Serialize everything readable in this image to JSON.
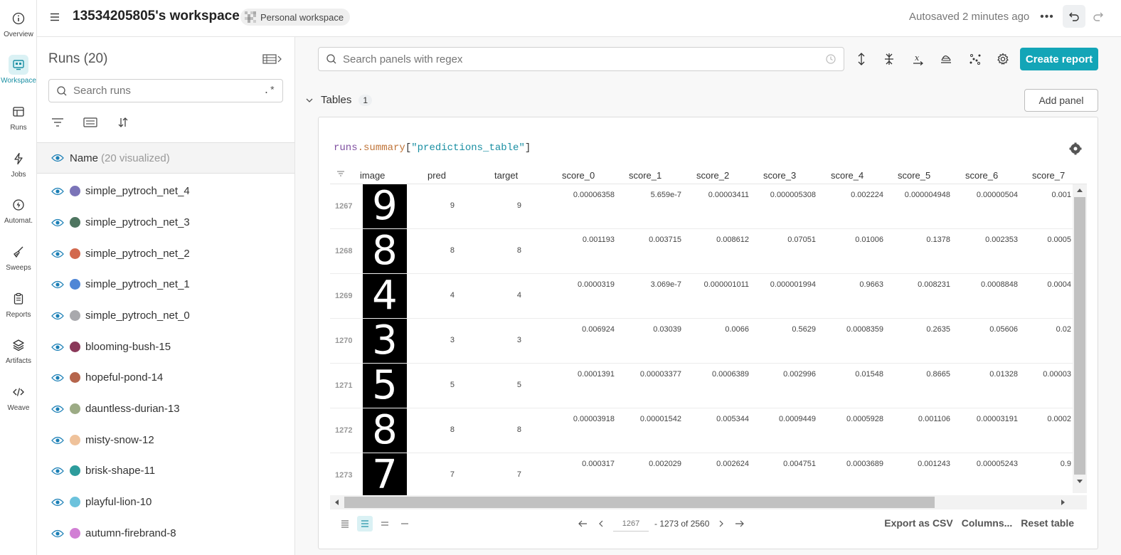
{
  "workspace": {
    "title": "13534205805's workspace",
    "badge": "Personal workspace",
    "autosaved": "Autosaved 2 minutes ago",
    "more_label": "•••"
  },
  "nav": [
    {
      "label": "Overview",
      "icon": "info-icon"
    },
    {
      "label": "Workspace",
      "icon": "workspace-icon",
      "active": true
    },
    {
      "label": "Runs",
      "icon": "table-icon"
    },
    {
      "label": "Jobs",
      "icon": "lightning-icon"
    },
    {
      "label": "Automat.",
      "icon": "automation-icon"
    },
    {
      "label": "Sweeps",
      "icon": "broom-icon"
    },
    {
      "label": "Reports",
      "icon": "clipboard-icon"
    },
    {
      "label": "Artifacts",
      "icon": "layers-icon"
    },
    {
      "label": "Weave",
      "icon": "code-icon"
    }
  ],
  "runs": {
    "title": "Runs (20)",
    "search_placeholder": "Search runs",
    "regex_label": ".*",
    "header_name": "Name",
    "header_visualized": "(20 visualized)",
    "items": [
      {
        "name": "simple_pytroch_net_4",
        "color": "#7b74b8"
      },
      {
        "name": "simple_pytroch_net_3",
        "color": "#4e7560"
      },
      {
        "name": "simple_pytroch_net_2",
        "color": "#d2694e"
      },
      {
        "name": "simple_pytroch_net_1",
        "color": "#4f86d6"
      },
      {
        "name": "simple_pytroch_net_0",
        "color": "#a9a9ad"
      },
      {
        "name": "blooming-bush-15",
        "color": "#8a3859"
      },
      {
        "name": "hopeful-pond-14",
        "color": "#b5654c"
      },
      {
        "name": "dauntless-durian-13",
        "color": "#9cab85"
      },
      {
        "name": "misty-snow-12",
        "color": "#efc29b"
      },
      {
        "name": "brisk-shape-11",
        "color": "#2d9c9c"
      },
      {
        "name": "playful-lion-10",
        "color": "#6cc2dc"
      },
      {
        "name": "autumn-firebrand-8",
        "color": "#d17fd4"
      }
    ]
  },
  "main": {
    "search_placeholder": "Search panels with regex",
    "create_report": "Create report",
    "section_title": "Tables",
    "section_count": "1",
    "add_panel": "Add panel"
  },
  "table": {
    "expr": {
      "p1": "runs",
      "p2": ".summary",
      "p3": "[",
      "p4": "\"predictions_table\"",
      "p5": "]"
    },
    "columns": [
      "image",
      "pred",
      "target",
      "score_0",
      "score_1",
      "score_2",
      "score_3",
      "score_4",
      "score_5",
      "score_6",
      "score_7"
    ],
    "rows": [
      {
        "idx": "1267",
        "digit": "9",
        "pred": "9",
        "target": "9",
        "scores": [
          "0.00006358",
          "5.659e-7",
          "0.00003411",
          "0.000005308",
          "0.002224",
          "0.000004948",
          "0.00000504",
          "0.001"
        ]
      },
      {
        "idx": "1268",
        "digit": "8",
        "pred": "8",
        "target": "8",
        "scores": [
          "0.001193",
          "0.003715",
          "0.008612",
          "0.07051",
          "0.01006",
          "0.1378",
          "0.002353",
          "0.0005"
        ]
      },
      {
        "idx": "1269",
        "digit": "4",
        "pred": "4",
        "target": "4",
        "scores": [
          "0.0000319",
          "3.069e-7",
          "0.000001011",
          "0.000001994",
          "0.9663",
          "0.008231",
          "0.0008848",
          "0.0004"
        ]
      },
      {
        "idx": "1270",
        "digit": "3",
        "pred": "3",
        "target": "3",
        "scores": [
          "0.006924",
          "0.03039",
          "0.0066",
          "0.5629",
          "0.0008359",
          "0.2635",
          "0.05606",
          "0.02"
        ]
      },
      {
        "idx": "1271",
        "digit": "5",
        "pred": "5",
        "target": "5",
        "scores": [
          "0.0001391",
          "0.00003377",
          "0.0006389",
          "0.002996",
          "0.01548",
          "0.8665",
          "0.01328",
          "0.00003"
        ]
      },
      {
        "idx": "1272",
        "digit": "8",
        "pred": "8",
        "target": "8",
        "scores": [
          "0.00003918",
          "0.00001542",
          "0.005344",
          "0.0009449",
          "0.0005928",
          "0.001106",
          "0.00003191",
          "0.0002"
        ]
      },
      {
        "idx": "1273",
        "digit": "7",
        "pred": "7",
        "target": "7",
        "scores": [
          "0.000317",
          "0.002029",
          "0.002624",
          "0.004751",
          "0.0003689",
          "0.001243",
          "0.00005243",
          "0.9"
        ]
      }
    ],
    "pager": {
      "current": "1267",
      "range": "- 1273 of 2560"
    },
    "export_csv": "Export as CSV",
    "columns_btn": "Columns...",
    "reset_table": "Reset table"
  }
}
